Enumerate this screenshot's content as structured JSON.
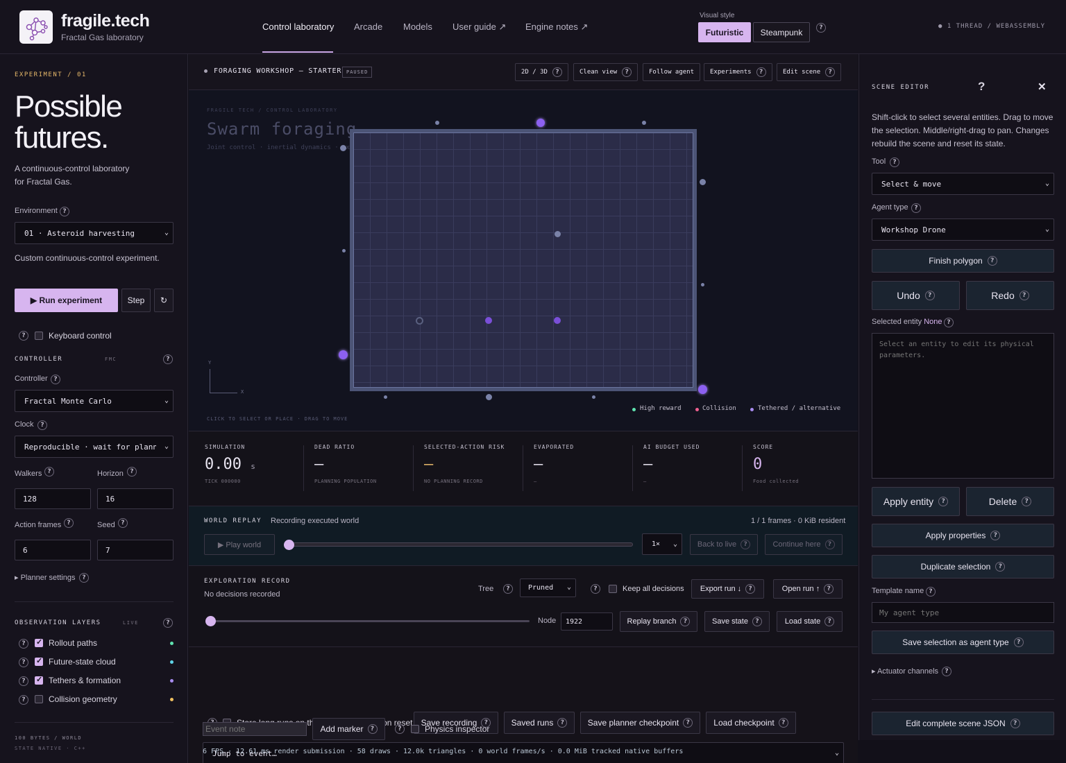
{
  "brand": {
    "title": "fragile.tech",
    "subtitle": "Fractal Gas laboratory"
  },
  "nav": [
    {
      "label": "Control laboratory"
    },
    {
      "label": "Arcade"
    },
    {
      "label": "Models"
    },
    {
      "label": "User guide ↗"
    },
    {
      "label": "Engine notes ↗"
    }
  ],
  "visual_style": {
    "label": "Visual style",
    "options": [
      "Futuristic",
      "Steampunk"
    ],
    "selected": "Futuristic"
  },
  "thread_info": "● 1 THREAD / WEBASSEMBLY",
  "left": {
    "eyebrow": "EXPERIMENT / 01",
    "headline_1": "Possible",
    "headline_2": "futures.",
    "desc_1": "A continuous-control laboratory",
    "desc_2": "for Fractal Gas.",
    "environment_label": "Environment",
    "environment_value": "01 · Asteroid harvesting",
    "environment_note": "Custom continuous-control experiment.",
    "run_label": "▶ Run experiment",
    "step_label": "Step",
    "reset_glyph": "↻",
    "keyboard_label": "Keyboard control",
    "controller_heading": "CONTROLLER",
    "controller_tag": "FMC",
    "controller_label": "Controller",
    "controller_value": "Fractal Monte Carlo",
    "clock_label": "Clock",
    "clock_value": "Reproducible · wait for planner",
    "walkers_label": "Walkers",
    "walkers_value": "128",
    "horizon_label": "Horizon",
    "horizon_value": "16",
    "action_frames_label": "Action frames",
    "action_frames_value": "6",
    "seed_label": "Seed",
    "seed_value": "7",
    "planner_settings": "▸ Planner settings",
    "layers_heading": "OBSERVATION LAYERS",
    "layers_tag": "LIVE",
    "layers": [
      {
        "label": "Rollout paths",
        "checked": true,
        "color": "#5fe3b0"
      },
      {
        "label": "Future-state cloud",
        "checked": true,
        "color": "#5fd4e8"
      },
      {
        "label": "Tethers & formation",
        "checked": true,
        "color": "#a88cf0"
      },
      {
        "label": "Collision geometry",
        "checked": false,
        "color": "#f0c060"
      }
    ],
    "footer_1": "100 BYTES / WORLD",
    "footer_2": "STATE NATIVE · C++"
  },
  "toolbar": {
    "scene_title": "FORAGING WORKSHOP — STARTER",
    "status": "PAUSED",
    "buttons": [
      "2D / 3D",
      "Clean view",
      "Follow agent",
      "Experiments",
      "Edit scene"
    ]
  },
  "viewport": {
    "eyebrow": "FRAGILE TECH / CONTROL LABORATORY",
    "title": "Swarm foraging",
    "subtitle": "Joint control · inertial dynamics · exact state replay",
    "axis_y": "Y",
    "axis_x": "X",
    "hint": "CLICK TO SELECT OR PLACE · DRAG TO MOVE",
    "legend": [
      {
        "label": "High reward",
        "color": "#5fe3b0"
      },
      {
        "label": "Collision",
        "color": "#f06090"
      },
      {
        "label": "Tethered / alternative",
        "color": "#a88cf0"
      }
    ]
  },
  "stats": [
    {
      "heading": "SIMULATION",
      "value": "0.00",
      "unit": "s",
      "sub": "TICK 000000"
    },
    {
      "heading": "DEAD RATIO",
      "value": "—",
      "unit": "",
      "sub": "PLANNING POPULATION"
    },
    {
      "heading": "SELECTED-ACTION RISK",
      "value": "—",
      "unit": "",
      "sub": "NO PLANNING RECORD"
    },
    {
      "heading": "EVAPORATED",
      "value": "—",
      "unit": "",
      "sub": "–"
    },
    {
      "heading": "AI BUDGET USED",
      "value": "—",
      "unit": "",
      "sub": "–"
    },
    {
      "heading": "SCORE",
      "value": "0",
      "unit": "",
      "sub": "Food collected"
    }
  ],
  "replay": {
    "heading": "WORLD REPLAY",
    "status": "Recording executed world",
    "frames": "1 / 1 frames · 0 KiB resident",
    "play_label": "▶ Play world",
    "speed": "1×",
    "back_label": "Back to live",
    "continue_label": "Continue here"
  },
  "explore": {
    "heading": "EXPLORATION RECORD",
    "status": "No decisions recorded",
    "tree_label": "Tree",
    "tree_value": "Pruned",
    "keep_label": "Keep all decisions",
    "export_label": "Export run ↓",
    "open_label": "Open run ↑",
    "node_label": "Node",
    "node_value": "1922",
    "replay_branch": "Replay branch",
    "save_state": "Save state",
    "load_state": "Load state"
  },
  "bottom": {
    "store_label": "Store long runs on this device · applies on reset",
    "save_recording": "Save recording",
    "saved_runs": "Saved runs",
    "save_checkpoint": "Save planner checkpoint",
    "load_checkpoint": "Load checkpoint",
    "jump_placeholder": "Jump to event…",
    "event_note_placeholder": "Event note",
    "add_marker": "Add marker",
    "physics_label": "Physics inspector",
    "perf": "6 FPS · 12.61 ms render submission · 58 draws · 12.0k triangles · 0 world frames/s · 0.0 MiB tracked native buffers"
  },
  "right": {
    "heading": "SCENE EDITOR",
    "help_glyph": "?",
    "close_glyph": "✕",
    "intro": "Shift-click to select several entities. Drag to move the selection. Middle/right-drag to pan. Changes rebuild the scene and reset its state.",
    "tool_label": "Tool",
    "tool_value": "Select & move",
    "agent_type_label": "Agent type",
    "agent_type_value": "Workshop Drone",
    "finish_polygon": "Finish polygon",
    "undo": "Undo",
    "redo": "Redo",
    "selected_entity_label": "Selected entity",
    "selected_entity_value": "None",
    "entity_placeholder": "Select an entity to edit its physical parameters.",
    "apply_entity": "Apply entity",
    "delete": "Delete",
    "apply_properties": "Apply properties",
    "duplicate_selection": "Duplicate selection",
    "template_label": "Template name",
    "template_placeholder": "My agent type",
    "save_agent_type": "Save selection as agent type",
    "actuator_channels": "▸ Actuator channels",
    "edit_json": "Edit complete scene JSON"
  }
}
